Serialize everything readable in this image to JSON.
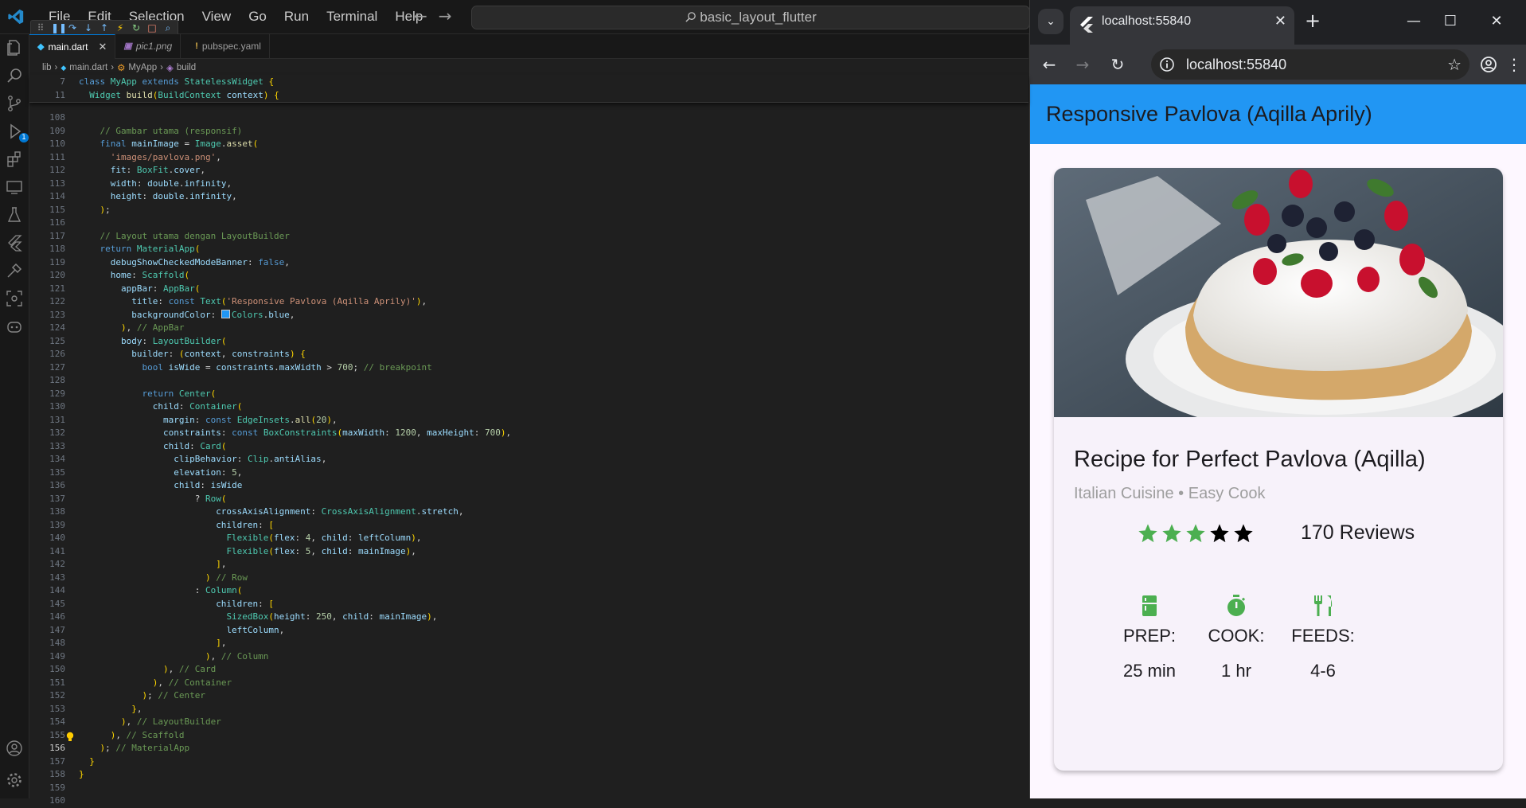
{
  "vscode": {
    "menu": [
      "File",
      "Edit",
      "Selection",
      "View",
      "Go",
      "Run",
      "Terminal",
      "Help"
    ],
    "search_text": "basic_layout_flutter",
    "debug_badge": "1",
    "tabs": [
      {
        "label": "main.dart",
        "active": true,
        "icon": "dart-icon"
      },
      {
        "label": "pic1.png",
        "active": false,
        "icon": "image-file-icon"
      },
      {
        "label": "pubspec.yaml",
        "active": false,
        "icon": "yaml-icon"
      }
    ],
    "breadcrumb": [
      "lib",
      "main.dart",
      "MyApp",
      "build"
    ],
    "sticky": [
      {
        "n": "7",
        "code": "class MyApp extends StatelessWidget {"
      },
      {
        "n": "11",
        "code": "  Widget build(BuildContext context) {"
      }
    ],
    "lines": [
      {
        "n": "108",
        "code": ""
      },
      {
        "n": "109",
        "code": "    // Gambar utama (responsif)"
      },
      {
        "n": "110",
        "code": "    final mainImage = Image.asset("
      },
      {
        "n": "111",
        "code": "      'images/pavlova.png',"
      },
      {
        "n": "112",
        "code": "      fit: BoxFit.cover,"
      },
      {
        "n": "113",
        "code": "      width: double.infinity,"
      },
      {
        "n": "114",
        "code": "      height: double.infinity,"
      },
      {
        "n": "115",
        "code": "    );"
      },
      {
        "n": "116",
        "code": ""
      },
      {
        "n": "117",
        "code": "    // Layout utama dengan LayoutBuilder"
      },
      {
        "n": "118",
        "code": "    return MaterialApp("
      },
      {
        "n": "119",
        "code": "      debugShowCheckedModeBanner: false,"
      },
      {
        "n": "120",
        "code": "      home: Scaffold("
      },
      {
        "n": "121",
        "code": "        appBar: AppBar("
      },
      {
        "n": "122",
        "code": "          title: const Text('Responsive Pavlova (Aqilla Aprily)'),"
      },
      {
        "n": "123",
        "code": "          backgroundColor: Colors.blue,"
      },
      {
        "n": "124",
        "code": "        ), // AppBar"
      },
      {
        "n": "125",
        "code": "        body: LayoutBuilder("
      },
      {
        "n": "126",
        "code": "          builder: (context, constraints) {"
      },
      {
        "n": "127",
        "code": "            bool isWide = constraints.maxWidth > 700; // breakpoint"
      },
      {
        "n": "128",
        "code": ""
      },
      {
        "n": "129",
        "code": "            return Center("
      },
      {
        "n": "130",
        "code": "              child: Container("
      },
      {
        "n": "131",
        "code": "                margin: const EdgeInsets.all(20),"
      },
      {
        "n": "132",
        "code": "                constraints: const BoxConstraints(maxWidth: 1200, maxHeight: 700),"
      },
      {
        "n": "133",
        "code": "                child: Card("
      },
      {
        "n": "134",
        "code": "                  clipBehavior: Clip.antiAlias,"
      },
      {
        "n": "135",
        "code": "                  elevation: 5,"
      },
      {
        "n": "136",
        "code": "                  child: isWide"
      },
      {
        "n": "137",
        "code": "                      ? Row("
      },
      {
        "n": "138",
        "code": "                          crossAxisAlignment: CrossAxisAlignment.stretch,"
      },
      {
        "n": "139",
        "code": "                          children: ["
      },
      {
        "n": "140",
        "code": "                            Flexible(flex: 4, child: leftColumn),"
      },
      {
        "n": "141",
        "code": "                            Flexible(flex: 5, child: mainImage),"
      },
      {
        "n": "142",
        "code": "                          ],"
      },
      {
        "n": "143",
        "code": "                        ) // Row"
      },
      {
        "n": "144",
        "code": "                      : Column("
      },
      {
        "n": "145",
        "code": "                          children: ["
      },
      {
        "n": "146",
        "code": "                            SizedBox(height: 250, child: mainImage),"
      },
      {
        "n": "147",
        "code": "                            leftColumn,"
      },
      {
        "n": "148",
        "code": "                          ],"
      },
      {
        "n": "149",
        "code": "                        ), // Column"
      },
      {
        "n": "150",
        "code": "                ), // Card"
      },
      {
        "n": "151",
        "code": "              ), // Container"
      },
      {
        "n": "152",
        "code": "            ); // Center"
      },
      {
        "n": "153",
        "code": "          },"
      },
      {
        "n": "154",
        "code": "        ), // LayoutBuilder"
      },
      {
        "n": "155",
        "code": "      ), // Scaffold"
      },
      {
        "n": "156",
        "code": "    ); // MaterialApp"
      },
      {
        "n": "157",
        "code": "  }"
      },
      {
        "n": "158",
        "code": "}"
      },
      {
        "n": "159",
        "code": ""
      },
      {
        "n": "160",
        "code": ""
      }
    ],
    "current_line": "156"
  },
  "browser": {
    "tab_title": "localhost:55840",
    "url": "localhost:55840",
    "app": {
      "appbar_title": "Responsive Pavlova (Aqilla Aprily)",
      "appbar_color": "#2196f3",
      "recipe_title": "Recipe for Perfect Pavlova (Aqilla)",
      "recipe_subtitle": "Italian Cuisine • Easy Cook",
      "rating": {
        "filled": 3,
        "total": 5,
        "filled_color": "#4caf50"
      },
      "reviews": "170 Reviews",
      "info": [
        {
          "icon": "kitchen-icon",
          "label": "PREP:",
          "value": "25 min"
        },
        {
          "icon": "timer-icon",
          "label": "COOK:",
          "value": "1 hr"
        },
        {
          "icon": "restaurant-icon",
          "label": "FEEDS:",
          "value": "4-6"
        }
      ],
      "accent_color": "#4caf50"
    }
  }
}
